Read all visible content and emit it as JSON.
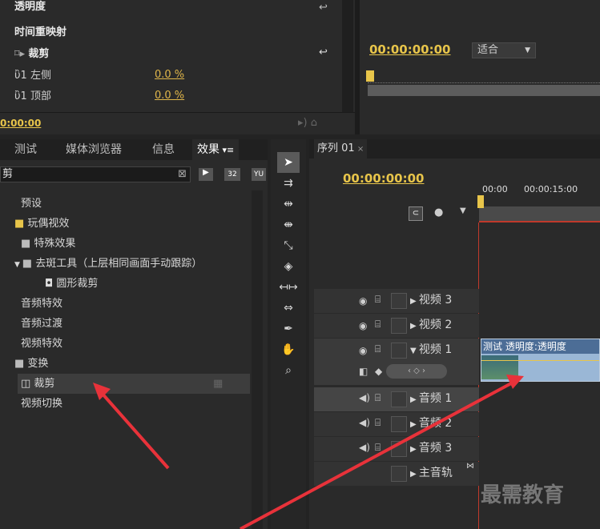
{
  "effect_controls": {
    "rows": [
      {
        "label": "透明度"
      },
      {
        "label": "时间重映射"
      },
      {
        "label": "裁剪"
      },
      {
        "label": "左侧",
        "value": "0.0 %"
      },
      {
        "label": "顶部",
        "value": "0.0 %"
      }
    ],
    "timecode": "0:00:00"
  },
  "program_monitor": {
    "timecode": "00:00:00:00",
    "fit_label": "适合"
  },
  "project_panel": {
    "tabs": [
      "测试",
      "媒体浏览器",
      "信息",
      "效果"
    ],
    "search_value": "剪",
    "tree": [
      {
        "label": "预设"
      },
      {
        "label": "玩偶视效"
      },
      {
        "label": "特殊效果"
      },
      {
        "label": "去斑工具（上层相同画面手动跟踪）"
      },
      {
        "label": "圆形裁剪"
      },
      {
        "label": "音频特效"
      },
      {
        "label": "音频过渡"
      },
      {
        "label": "视频特效"
      },
      {
        "label": "变换"
      },
      {
        "label": "裁剪"
      },
      {
        "label": "视频切换"
      }
    ]
  },
  "sequence": {
    "tab_label": "序列 01",
    "timecode": "00:00:00:00",
    "ruler": [
      "00:00",
      "00:00:15:00"
    ],
    "tracks": [
      "视频 3",
      "视频 2",
      "视频 1",
      "音频 1",
      "音频 2",
      "音频 3",
      "主音轨"
    ],
    "clip_label": "测试 透明度:透明度"
  },
  "watermark": "最需教育",
  "colors": {
    "accent": "#e8c54a",
    "arrow": "#e8323a",
    "selection": "#3d3d3d"
  }
}
